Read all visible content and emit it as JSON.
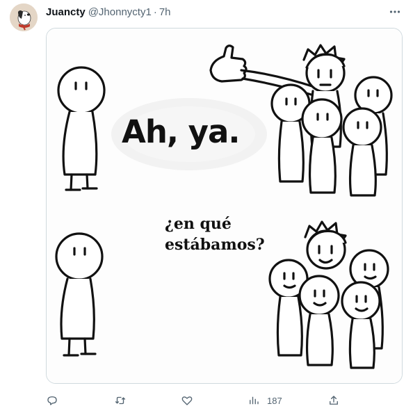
{
  "tweet": {
    "author_name": "Juancty",
    "handle": "@Jhonnycty1",
    "separator": "·",
    "time": "7h",
    "media": {
      "bubble_text": "Ah, ya.",
      "caption_line1": "¿en qué",
      "caption_line2": "estábamos?"
    },
    "actions": {
      "reply_icon": "reply-icon",
      "retweet_icon": "retweet-icon",
      "like_icon": "like-icon",
      "views_icon": "views-icon",
      "views_count": "187",
      "share_icon": "share-icon"
    },
    "more_icon": "more-icon"
  },
  "colors": {
    "text_primary": "#0f1419",
    "text_secondary": "#536471",
    "border": "#cfd9de"
  }
}
